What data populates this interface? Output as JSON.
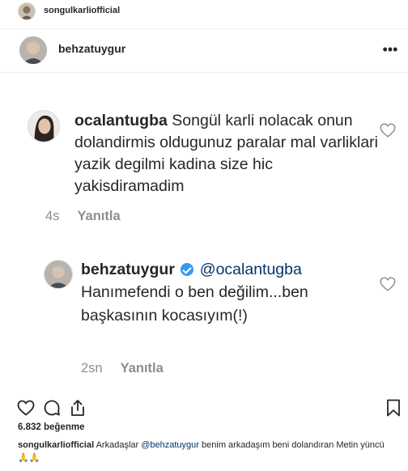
{
  "owner": {
    "username": "songulkarliofficial",
    "avatar_icon": "profile-photo"
  },
  "post": {
    "username": "behzatuygur",
    "avatar_icon": "profile-photo",
    "more_icon": "ellipsis-icon",
    "more_glyph": "•••"
  },
  "comments": [
    {
      "username": "ocalantugba",
      "text": "Songül karli nolacak onun dolandirmis oldugunuz paralar mal varliklari yazik degilmi kadina size hic yakisdiramadim",
      "time": "4s",
      "reply_label": "Yanıtla",
      "heart_icon": "heart-outline-icon"
    },
    {
      "username": "behzatuygur",
      "verified_icon": "verified-badge-icon",
      "mention": "@ocalantugba",
      "text": "Hanımefendi  o ben değilim...ben başkasının kocasıyım(!)",
      "time": "2sn",
      "reply_label": "Yanıtla",
      "heart_icon": "heart-outline-icon"
    }
  ],
  "actions": {
    "like_icon": "heart-outline-icon",
    "comment_icon": "comment-icon",
    "share_icon": "share-icon",
    "save_icon": "bookmark-icon"
  },
  "likes_text": "6.832 beğenme",
  "caption": {
    "username": "songulkarliofficial",
    "text_before": "Arkadaşlar",
    "mention": "@behzatuygur",
    "text_after": "benim arkadaşım beni dolandıran Metin yüncü",
    "emoji": "🙏🙏"
  },
  "colors": {
    "link": "#003569",
    "meta": "#8e8e8e",
    "verified": "#3897f0",
    "text": "#262626"
  }
}
